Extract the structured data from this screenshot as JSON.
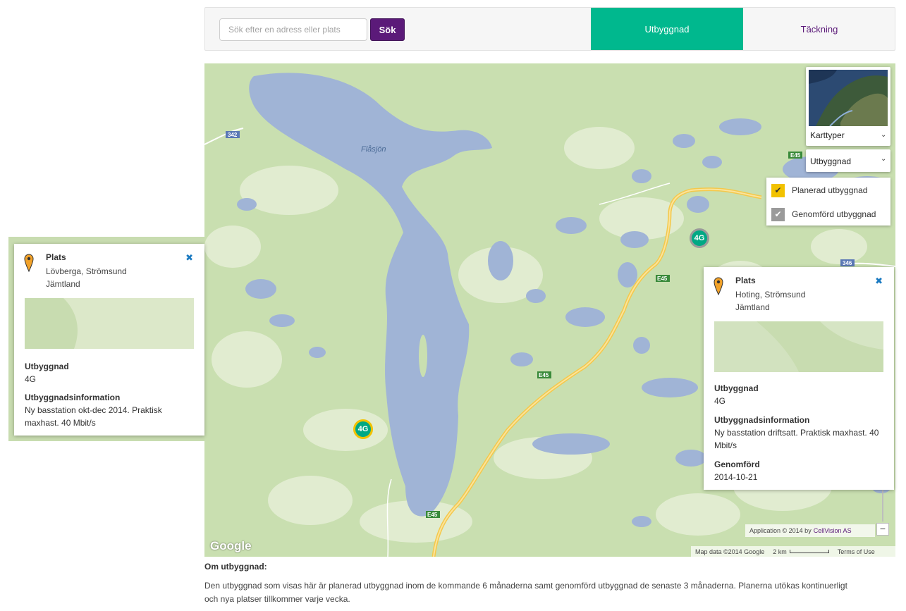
{
  "search": {
    "placeholder": "Sök efter en adress eller plats",
    "button_label": "Sök"
  },
  "tabs": [
    {
      "label": "Utbyggnad",
      "active": true
    },
    {
      "label": "Täckning",
      "active": false
    }
  ],
  "colors": {
    "accent": "#00b88e",
    "brand": "#5b1a79",
    "planned": "#f2c200",
    "done": "#9a9a9a",
    "water": "#a0b4d6",
    "land": "#c9dfb0"
  },
  "map": {
    "place_label": "Flåsjön",
    "road_labels": [
      "342",
      "E45",
      "E45",
      "E45",
      "E45",
      "346"
    ],
    "map_type_label": "Karttyper",
    "layer_label": "Utbyggnad",
    "legend": [
      {
        "label": "Planerad utbyggnad",
        "icon": "check-icon"
      },
      {
        "label": "Genomförd utbyggnad",
        "icon": "check-icon"
      }
    ],
    "markers": [
      {
        "label": "4G",
        "status": "planned"
      },
      {
        "label": "4G",
        "status": "done"
      }
    ],
    "attribution_prefix": "Application © 2014 by",
    "attribution_link": "CellVision AS",
    "map_data": "Map data ©2014 Google",
    "scale": "2 km",
    "terms": "Terms of Use",
    "google": "Google",
    "zoom_out": "−"
  },
  "info_left": {
    "title": "Plats",
    "address_line1": "Lövberga, Strömsund",
    "address_line2": "Jämtland",
    "type_heading": "Utbyggnad",
    "type_value": "4G",
    "details_heading": "Utbyggnadsinformation",
    "details_value": "Ny basstation okt-dec 2014. Praktisk maxhast. 40 Mbit/s"
  },
  "info_right": {
    "title": "Plats",
    "address_line1": "Hoting, Strömsund",
    "address_line2": "Jämtland",
    "type_heading": "Utbyggnad",
    "type_value": "4G",
    "details_heading": "Utbyggnadsinformation",
    "details_value": "Ny basstation driftsatt. Praktisk maxhast. 40 Mbit/s",
    "done_heading": "Genomförd",
    "done_value": "2014-10-21"
  },
  "about": {
    "title": "Om utbyggnad:",
    "text": "Den utbyggnad som visas här är planerad utbyggnad inom de kommande 6 månaderna samt genomförd utbyggnad de senaste 3 månaderna. Planerna utökas kontinuerligt och nya platser tillkommer varje vecka."
  }
}
